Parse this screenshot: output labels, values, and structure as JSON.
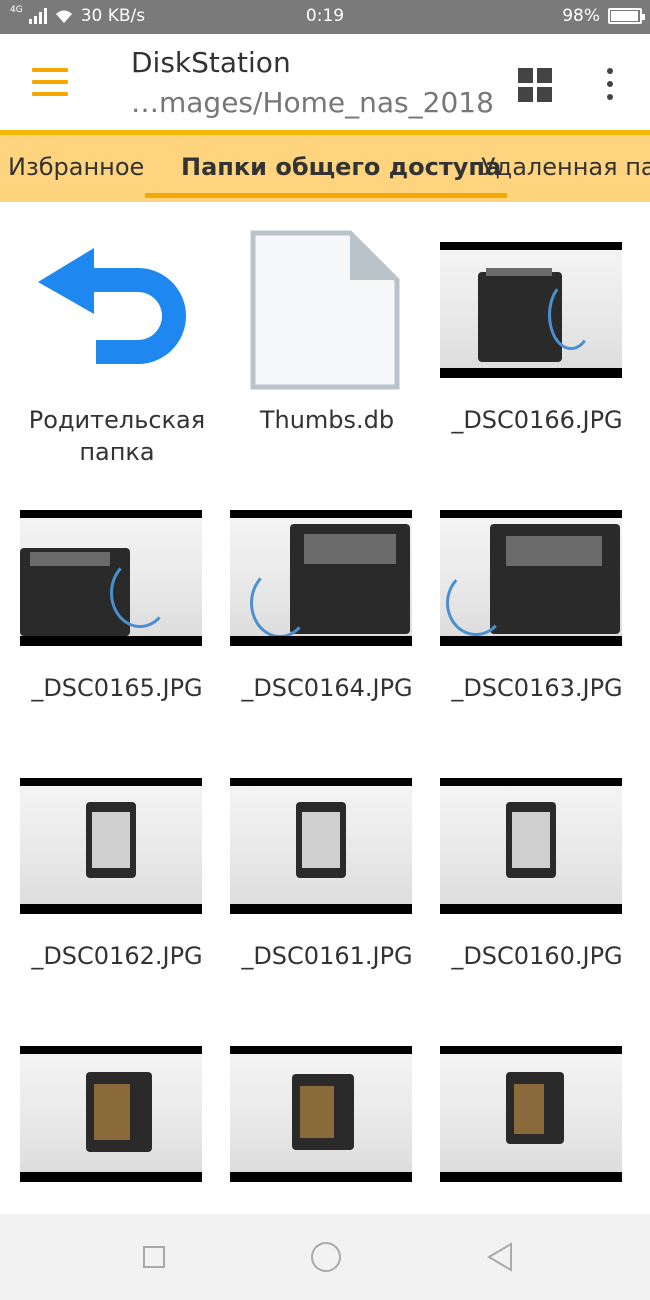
{
  "status_bar": {
    "network": "4G",
    "speed": "30 KB/s",
    "time": "0:19",
    "battery": "98%",
    "battery_level": 0.98
  },
  "app_bar": {
    "title": "DiskStation",
    "path": "…mages/Home_nas_2018",
    "menu_icon": "hamburger-menu-icon",
    "view_icon": "grid-view-icon",
    "more_icon": "more-vert-icon"
  },
  "tabs": [
    {
      "label": "Избранное",
      "active": false
    },
    {
      "label": "Папки общего доступа",
      "active": true
    },
    {
      "label": "Удаленная па",
      "active": false
    }
  ],
  "files": [
    {
      "name": "Родительская папка",
      "type": "parent"
    },
    {
      "name": "Thumbs.db",
      "type": "file"
    },
    {
      "name": "_DSC0166.JPG",
      "type": "image"
    },
    {
      "name": "_DSC0165.JPG",
      "type": "image"
    },
    {
      "name": "_DSC0164.JPG",
      "type": "image"
    },
    {
      "name": "_DSC0163.JPG",
      "type": "image"
    },
    {
      "name": "_DSC0162.JPG",
      "type": "image"
    },
    {
      "name": "_DSC0161.JPG",
      "type": "image"
    },
    {
      "name": "_DSC0160.JPG",
      "type": "image"
    },
    {
      "name": "",
      "type": "image"
    },
    {
      "name": "",
      "type": "image"
    },
    {
      "name": "",
      "type": "image"
    }
  ],
  "colors": {
    "accent": "#f5a800",
    "tab_background": "#ffd47f",
    "parent_arrow": "#1e88f0"
  },
  "nav_bar": {
    "recent_icon": "square-recent-icon",
    "home_icon": "circle-home-icon",
    "back_icon": "triangle-back-icon"
  }
}
